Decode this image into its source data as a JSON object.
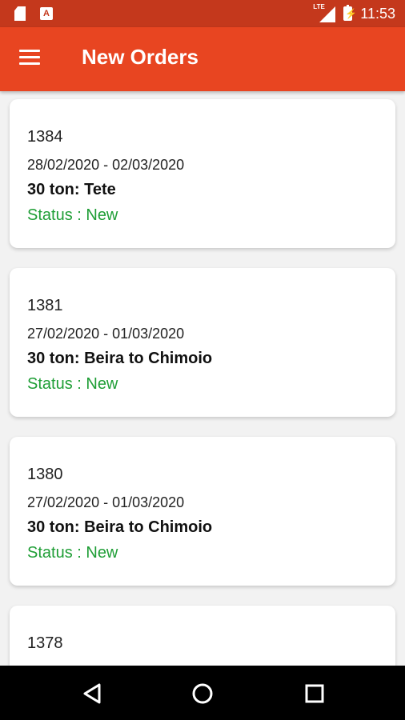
{
  "status_bar": {
    "time": "11:53",
    "network_label": "LTE",
    "icons": [
      "sd-card-icon",
      "a-app-icon",
      "lte-signal-icon",
      "battery-charging-icon"
    ]
  },
  "app_bar": {
    "title": "New Orders",
    "menu_icon": "hamburger-menu-icon"
  },
  "orders": [
    {
      "id": "1384",
      "dates": "28/02/2020 - 02/03/2020",
      "route": "30 ton: Tete",
      "status": "Status : New"
    },
    {
      "id": "1381",
      "dates": "27/02/2020 - 01/03/2020",
      "route": "30 ton: Beira to Chimoio",
      "status": "Status : New"
    },
    {
      "id": "1380",
      "dates": "27/02/2020 - 01/03/2020",
      "route": "30 ton: Beira to Chimoio",
      "status": "Status : New"
    },
    {
      "id": "1378",
      "dates": "",
      "route": "",
      "status": ""
    }
  ],
  "colors": {
    "status_bar": "#c4381c",
    "app_bar": "#e84521",
    "status_new": "#1f9e36",
    "background": "#f2f2f2"
  },
  "nav_bar": {
    "icons": [
      "back-icon",
      "home-icon",
      "recents-icon"
    ]
  }
}
